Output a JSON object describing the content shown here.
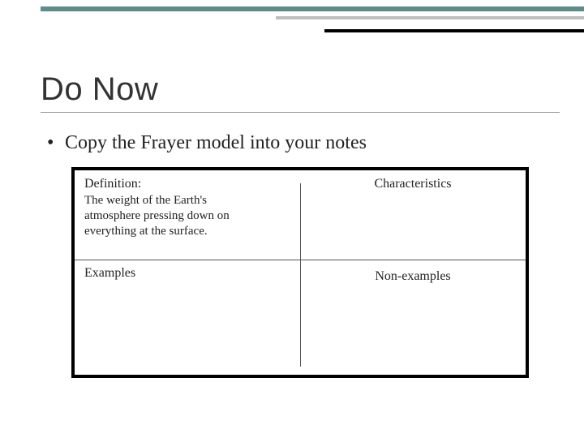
{
  "title": "Do Now",
  "bullet": "Copy the Frayer model into your notes",
  "frayer": {
    "definition": {
      "label": "Definition:",
      "text": "The weight of the Earth's atmosphere pressing down on everything at the surface."
    },
    "characteristics": {
      "label": "Characteristics"
    },
    "examples": {
      "label": "Examples"
    },
    "nonexamples": {
      "label": "Non-examples"
    }
  }
}
